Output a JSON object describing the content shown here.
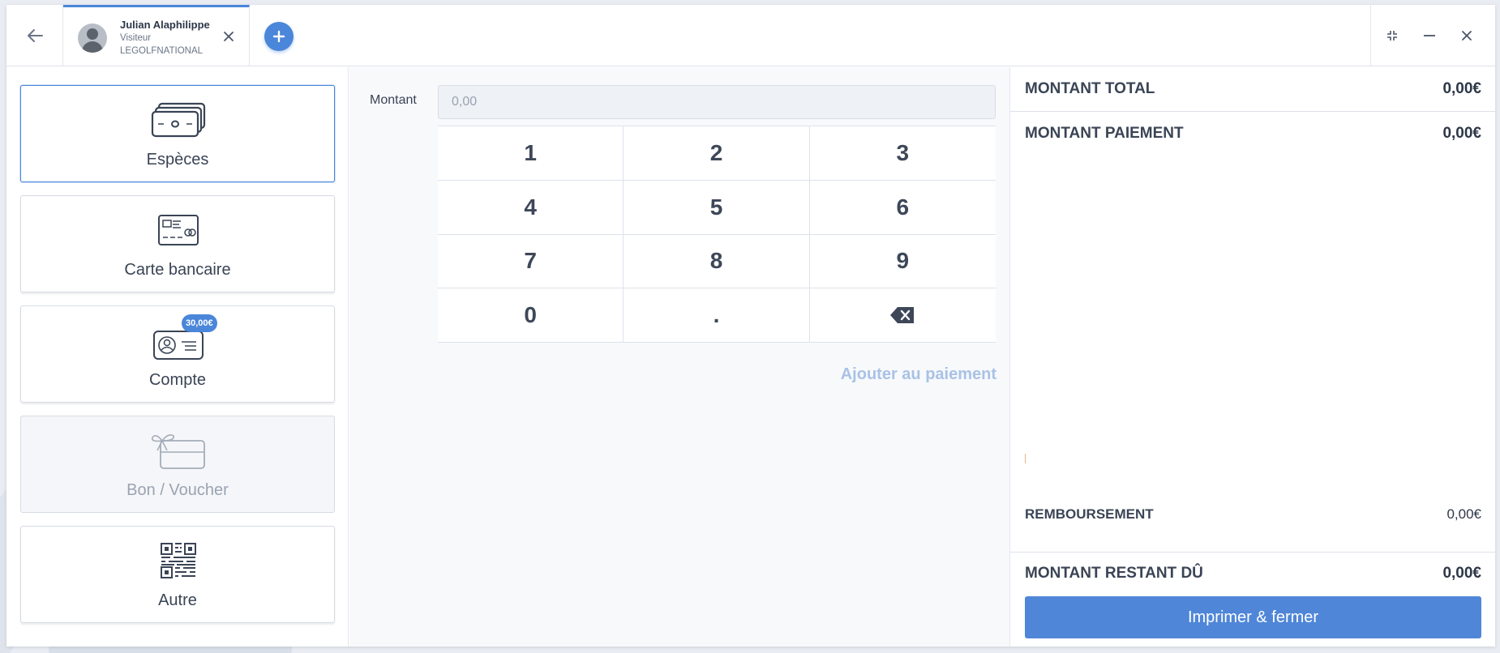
{
  "header": {
    "user_name": "Julian Alaphilippe",
    "user_role": "Visiteur",
    "user_club": "LEGOLFNATIONAL"
  },
  "methods": [
    {
      "label": "Espèces",
      "icon": "cash-icon",
      "state": "selected"
    },
    {
      "label": "Carte bancaire",
      "icon": "credit-card-icon",
      "state": "normal"
    },
    {
      "label": "Compte",
      "icon": "account-card-icon",
      "state": "normal",
      "badge": "30,00€"
    },
    {
      "label": "Bon / Voucher",
      "icon": "gift-voucher-icon",
      "state": "disabled"
    },
    {
      "label": "Autre",
      "icon": "qr-code-icon",
      "state": "normal"
    }
  ],
  "amount": {
    "label": "Montant",
    "placeholder": "0,00"
  },
  "keypad": {
    "keys": [
      "1",
      "2",
      "3",
      "4",
      "5",
      "6",
      "7",
      "8",
      "9",
      "0",
      ".",
      "backspace"
    ]
  },
  "add_to_payment_label": "Ajouter au paiement",
  "summary": {
    "total_label": "MONTANT TOTAL",
    "total_value": "0,00€",
    "payment_label": "MONTANT PAIEMENT",
    "payment_value": "0,00€",
    "refund_label": "REMBOURSEMENT",
    "refund_value": "0,00€",
    "remaining_label": "MONTANT RESTANT DÛ",
    "remaining_value": "0,00€"
  },
  "print_button_label": "Imprimer & fermer",
  "colors": {
    "accent": "#4a86d9",
    "add_to_payment_disabled": "#a9c2e6"
  }
}
